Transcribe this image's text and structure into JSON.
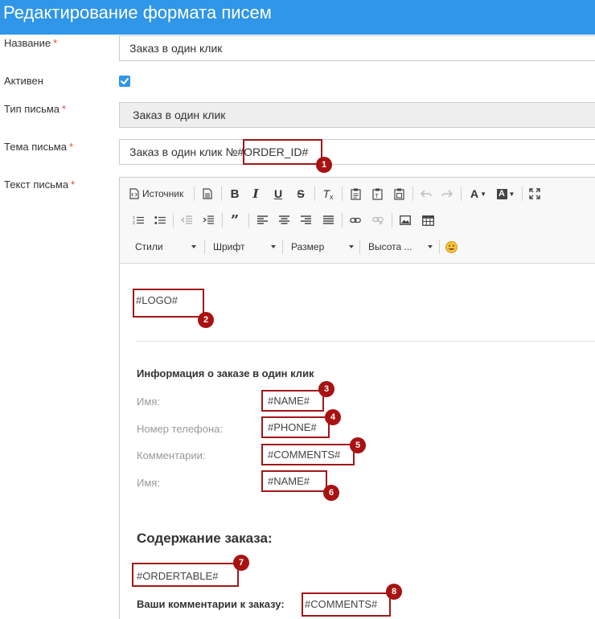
{
  "header": {
    "title": "Редактирование формата писем"
  },
  "form": {
    "name_label": "Название",
    "name_value": "Заказ в один клик",
    "active_label": "Активен",
    "active_checked": true,
    "type_label": "Тип письма",
    "type_value": "Заказ в один клик",
    "subject_label": "Тема письма",
    "subject_prefix": "Заказ в один клик №",
    "subject_placeholder": "#ORDER_ID#",
    "body_label": "Текст письма",
    "required_mark": "*"
  },
  "toolbar": {
    "source_label": "Источник",
    "styles_label": "Стили",
    "font_label": "Шрифт",
    "size_label": "Размер",
    "height_label": "Высота ..."
  },
  "editor": {
    "logo": "#LOGO#",
    "info_title": "Информация о заказе в один клик",
    "fields": [
      {
        "label": "Имя:",
        "value": "#NAME#"
      },
      {
        "label": "Номер телефона:",
        "value": "#PHONE#"
      },
      {
        "label": "Комментарии:",
        "value": "#COMMENTS#"
      },
      {
        "label": "Имя:",
        "value": "#NAME#"
      }
    ],
    "order_title": "Содержание заказа:",
    "order_table": "#ORDERTABLE#",
    "comments_label": "Ваши комментарии к заказу:",
    "comments_value": "#COMMENTS#"
  },
  "badges": [
    "1",
    "2",
    "3",
    "4",
    "5",
    "6",
    "7",
    "8"
  ],
  "colors": {
    "header_bg": "#2f96e8",
    "annotation": "#a11818",
    "required": "#e04a4a"
  }
}
